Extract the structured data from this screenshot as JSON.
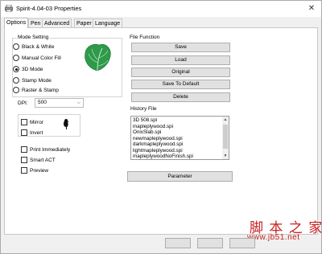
{
  "window": {
    "title": "Spirit-4.04-03 Properties",
    "close_glyph": "✕"
  },
  "tabs": [
    {
      "label": "Options",
      "active": true
    },
    {
      "label": "Pen"
    },
    {
      "label": "Advanced"
    },
    {
      "label": "Paper"
    },
    {
      "label": "Language"
    }
  ],
  "mode_setting": {
    "label": "Mode Setting",
    "options": [
      "Black & White",
      "Manual Color Fill",
      "3D Mode",
      "Stamp Mode",
      "Raster & Stamp"
    ],
    "selected": "3D Mode"
  },
  "dpi": {
    "label": "DPI:",
    "value": "500"
  },
  "checkboxes": {
    "mirror": "Mirror",
    "invert": "Invert",
    "print_immediately": "Print Immediately",
    "smart_act": "Smart ACT",
    "preview": "Preview"
  },
  "file_function": {
    "label": "File Function",
    "buttons": [
      "Save",
      "Load",
      "Original",
      "Save To Default",
      "Delete"
    ]
  },
  "history": {
    "label": "History File",
    "items": [
      "3D 508.spi",
      "mapleplywood.spi",
      "OnixSlab.spi",
      "newmapleplywood.spi",
      "darkmapleplywood.spi",
      "lightmapleplywood.spi",
      "mapleplywoodNoFinish.spi"
    ]
  },
  "parameter_button": "Parameter",
  "watermark": {
    "text": "脚 本 之 家",
    "url": "www.jb51.net"
  },
  "colors": {
    "watermark": "#c8201e",
    "leaf": "#2e9a4a"
  }
}
